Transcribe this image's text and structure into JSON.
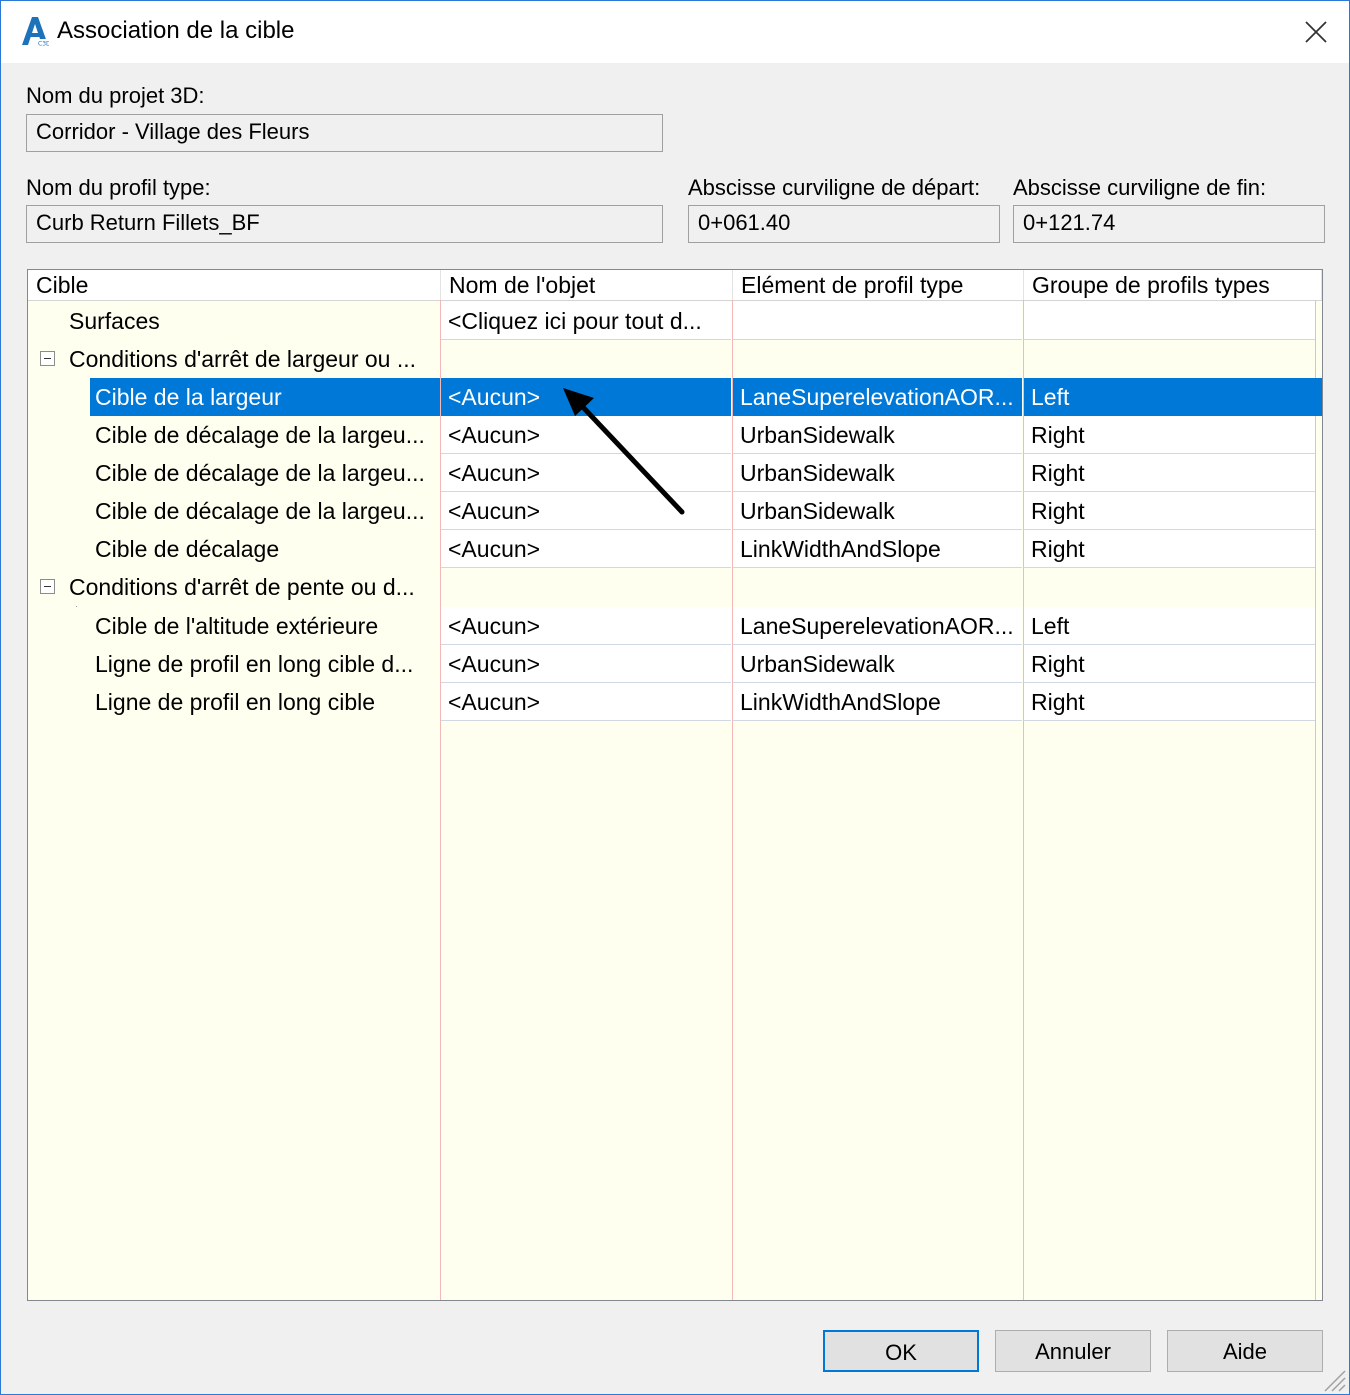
{
  "window": {
    "title": "Association de la cible",
    "app_icon": "autocad-civil-3d-logo",
    "close_icon": "close-icon"
  },
  "fields": {
    "project_label": "Nom du projet 3D:",
    "project_value": "Corridor - Village des Fleurs",
    "profile_label": "Nom du profil type:",
    "profile_value": "Curb Return Fillets_BF",
    "start_label": "Abscisse curviligne de départ:",
    "start_value": "0+061.40",
    "end_label": "Abscisse curviligne de fin:",
    "end_value": "0+121.74"
  },
  "grid": {
    "headers": [
      "Cible",
      "Nom de l'objet",
      "Elément de profil type",
      "Groupe de profils types"
    ],
    "rows": [
      {
        "label": "Surfaces",
        "object": "<Cliquez ici pour tout d...",
        "element": "",
        "group": ""
      },
      {
        "label": "Conditions d'arrêt de largeur ou ...",
        "object": "",
        "element": "",
        "group": ""
      },
      {
        "label": "Cible de la largeur",
        "object": "<Aucun>",
        "element": "LaneSuperelevationAOR...",
        "group": "Left"
      },
      {
        "label": "Cible de décalage de la largeu...",
        "object": "<Aucun>",
        "element": "UrbanSidewalk",
        "group": "Right"
      },
      {
        "label": "Cible de décalage de la largeu...",
        "object": "<Aucun>",
        "element": "UrbanSidewalk",
        "group": "Right"
      },
      {
        "label": "Cible de décalage de la largeu...",
        "object": "<Aucun>",
        "element": "UrbanSidewalk",
        "group": "Right"
      },
      {
        "label": "Cible de décalage",
        "object": "<Aucun>",
        "element": "LinkWidthAndSlope",
        "group": "Right"
      },
      {
        "label": "Conditions d'arrêt de pente ou d...",
        "object": "",
        "element": "",
        "group": ""
      },
      {
        "label": "Cible de l'altitude extérieure",
        "object": "<Aucun>",
        "element": "LaneSuperelevationAOR...",
        "group": "Left"
      },
      {
        "label": "Ligne de profil en long cible d...",
        "object": "<Aucun>",
        "element": "UrbanSidewalk",
        "group": "Right"
      },
      {
        "label": "Ligne de profil en long cible",
        "object": "<Aucun>",
        "element": "LinkWidthAndSlope",
        "group": "Right"
      }
    ]
  },
  "buttons": {
    "ok": "OK",
    "cancel": "Annuler",
    "help": "Aide"
  },
  "colors": {
    "selection": "#0078d7",
    "grid_bg": "#fffff0",
    "accent_border": "#2b79d7"
  }
}
